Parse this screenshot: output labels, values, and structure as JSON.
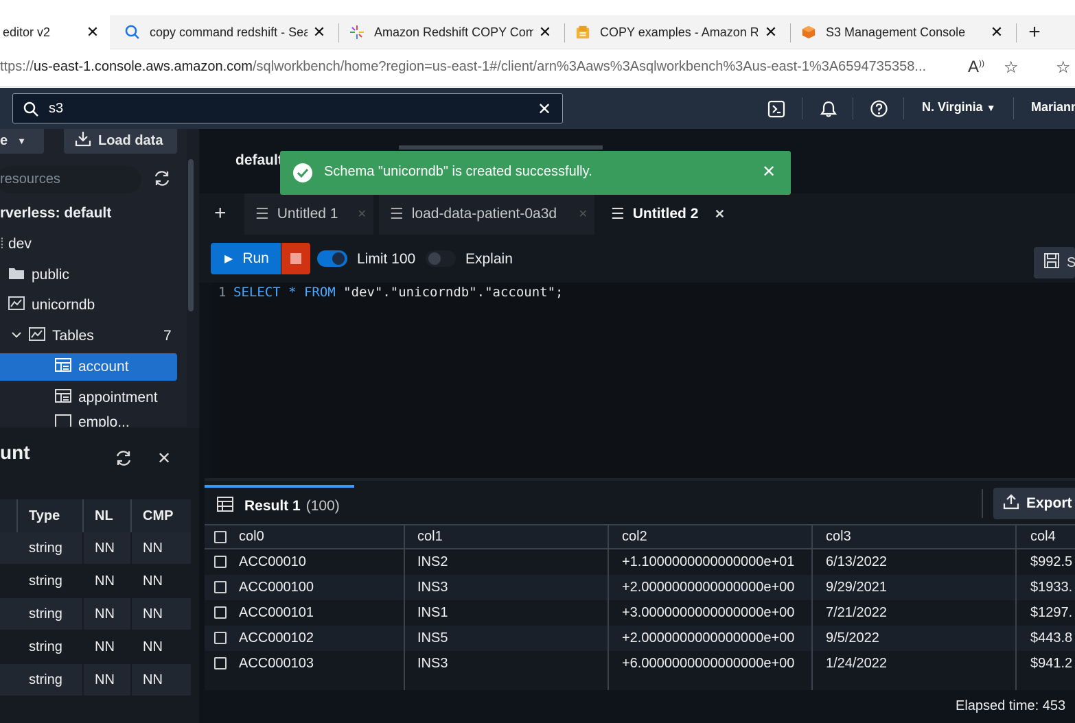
{
  "browser": {
    "tabs": [
      {
        "label": "editor v2",
        "icon": "page-icon"
      },
      {
        "label": "copy command redshift - Sea",
        "icon": "search-icon"
      },
      {
        "label": "Amazon Redshift COPY Com",
        "icon": "sparkle-icon"
      },
      {
        "label": "COPY examples - Amazon Re",
        "icon": "docs-icon"
      },
      {
        "label": "S3 Management Console",
        "icon": "s3-icon"
      }
    ],
    "new_tab": "+",
    "url_prefix": "ttps://",
    "url_host": "us-east-1.console.aws.amazon.com",
    "url_path": "/sqlworkbench/home?region=us-east-1#/client/arn%3Aaws%3Asqlworkbench%3Aus-east-1%3A6594735358..."
  },
  "header": {
    "search_value": "s3",
    "region": "N. Virginia",
    "user": "Mariann"
  },
  "sidebar": {
    "create_label": "e",
    "load_data_label": "Load data",
    "filter_placeholder": "resources",
    "connection": "rverless: default",
    "database": "dev",
    "schemas": [
      "public",
      "unicorndb"
    ],
    "tables_label": "Tables",
    "tables_count": "7",
    "tables": [
      "account",
      "appointment"
    ],
    "partial_item": "emplo..."
  },
  "details_panel": {
    "title": "unt",
    "columns": [
      "Type",
      "NL",
      "CMP"
    ],
    "rows": [
      [
        "string",
        "NN",
        "NN"
      ],
      [
        "string",
        "NN",
        "NN"
      ],
      [
        "string",
        "NN",
        "NN"
      ],
      [
        "string",
        "NN",
        "NN"
      ],
      [
        "string",
        "NN",
        "NN"
      ]
    ]
  },
  "editor": {
    "context_label": "default",
    "tabs": [
      "Untitled 1",
      "load-data-patient-0a3d",
      "Untitled 2"
    ],
    "run_label": "Run",
    "limit_label": "Limit 100",
    "explain_label": "Explain",
    "save_label": "S",
    "line_number": "1",
    "sql_kw1": "SELECT",
    "sql_star": " * ",
    "sql_kw2": "FROM",
    "sql_rest": " \"dev\".\"unicorndb\".\"account\";"
  },
  "toast": {
    "message": "Schema \"unicorndb\" is created successfully."
  },
  "results": {
    "tab_label": "Result 1",
    "tab_count": "(100)",
    "export_label": "Export",
    "columns": [
      "col0",
      "col1",
      "col2",
      "col3",
      "col4"
    ],
    "rows": [
      [
        "ACC00010",
        "INS2",
        "+1.1000000000000000e+01",
        "6/13/2022",
        "$992.5"
      ],
      [
        "ACC000100",
        "INS3",
        "+2.0000000000000000e+00",
        "9/29/2021",
        "$1933."
      ],
      [
        "ACC000101",
        "INS1",
        "+3.0000000000000000e+00",
        "7/21/2022",
        "$1297."
      ],
      [
        "ACC000102",
        "INS5",
        "+2.0000000000000000e+00",
        "9/5/2022",
        "$443.8"
      ],
      [
        "ACC000103",
        "INS3",
        "+6.0000000000000000e+00",
        "1/24/2022",
        "$941.2"
      ]
    ],
    "elapsed": "Elapsed time: 453"
  }
}
